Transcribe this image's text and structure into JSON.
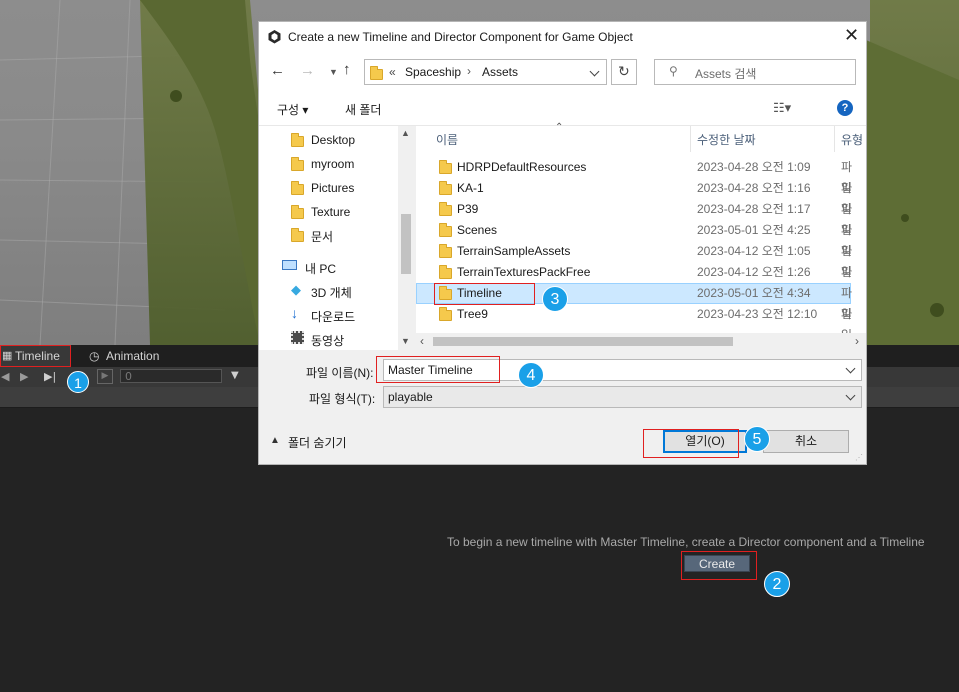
{
  "scene": {
    "description_colors": {
      "terrain": "#5c6b34",
      "ground": "#8a8a8a"
    }
  },
  "timeline_window": {
    "tabs": [
      {
        "label": "Timeline",
        "icon": "filmstrip-icon"
      },
      {
        "label": "Animation",
        "icon": "clock-icon"
      }
    ],
    "frame_value": "0",
    "empty_message": "To begin a new timeline with Master Timeline, create a Director component and a Timeline",
    "create_label": "Create"
  },
  "dialog": {
    "title": "Create a new Timeline and Director Component for Game Object",
    "path": {
      "prefix": "«",
      "segments": [
        "Spaceship",
        "Assets"
      ]
    },
    "search_placeholder": "Assets 검색",
    "commands": {
      "organize": "구성 ▾",
      "new_folder": "새 폴더"
    },
    "nav_items": [
      {
        "label": "Desktop",
        "icon": "folder-icon"
      },
      {
        "label": "myroom",
        "icon": "folder-icon"
      },
      {
        "label": "Pictures",
        "icon": "folder-icon"
      },
      {
        "label": "Texture",
        "icon": "folder-icon"
      },
      {
        "label": "문서",
        "icon": "folder-icon"
      },
      {
        "label": "내 PC",
        "icon": "pc-icon"
      },
      {
        "label": "3D 개체",
        "icon": "cube-icon"
      },
      {
        "label": "다운로드",
        "icon": "download-icon"
      },
      {
        "label": "동영상",
        "icon": "video-icon"
      }
    ],
    "columns": {
      "name": "이름",
      "date": "수정한 날짜",
      "type": "유형"
    },
    "files": [
      {
        "name": "HDRPDefaultResources",
        "date": "2023-04-28 오전 1:09",
        "type": "파일"
      },
      {
        "name": "KA-1",
        "date": "2023-04-28 오전 1:16",
        "type": "파일"
      },
      {
        "name": "P39",
        "date": "2023-04-28 오전 1:17",
        "type": "파일"
      },
      {
        "name": "Scenes",
        "date": "2023-05-01 오전 4:25",
        "type": "파일"
      },
      {
        "name": "TerrainSampleAssets",
        "date": "2023-04-12 오전 1:05",
        "type": "파일"
      },
      {
        "name": "TerrainTexturesPackFree",
        "date": "2023-04-12 오전 1:26",
        "type": "파일"
      },
      {
        "name": "Timeline",
        "date": "2023-05-01 오전 4:34",
        "type": "파일"
      },
      {
        "name": "Tree9",
        "date": "2023-04-23 오전 12:10",
        "type": "파일"
      }
    ],
    "filename_label": "파일 이름(N):",
    "filename_value": "Master Timeline",
    "filetype_label": "파일 형식(T):",
    "filetype_value": "playable",
    "hide_folders_label": "폴더 숨기기",
    "open_label": "열기(O)",
    "cancel_label": "취소"
  },
  "annotations": [
    "1",
    "2",
    "3",
    "4",
    "5"
  ]
}
